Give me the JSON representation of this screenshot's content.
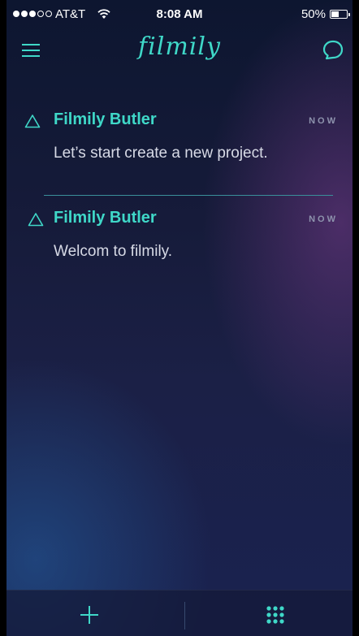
{
  "status_bar": {
    "carrier": "AT&T",
    "time": "8:08 AM",
    "battery_percent": "50%",
    "battery_level": 0.5,
    "signal_bars_filled": 3,
    "signal_bars_total": 5
  },
  "header": {
    "logo": "filmily",
    "menu_icon": "hamburger-menu-icon",
    "chat_icon": "chat-bubble-icon"
  },
  "notifications": [
    {
      "icon": "triangle-icon",
      "title": "Filmily Butler",
      "time": "NOW",
      "body": "Let’s start create a new project."
    },
    {
      "icon": "triangle-icon",
      "title": "Filmily Butler",
      "time": "NOW",
      "body": "Welcom to filmily."
    }
  ],
  "toolbar": {
    "add_icon": "plus-icon",
    "grid_icon": "grid-dots-icon"
  },
  "colors": {
    "accent": "#3fd8c8",
    "muted": "#8e93ad",
    "body_text": "#d7dae6"
  }
}
